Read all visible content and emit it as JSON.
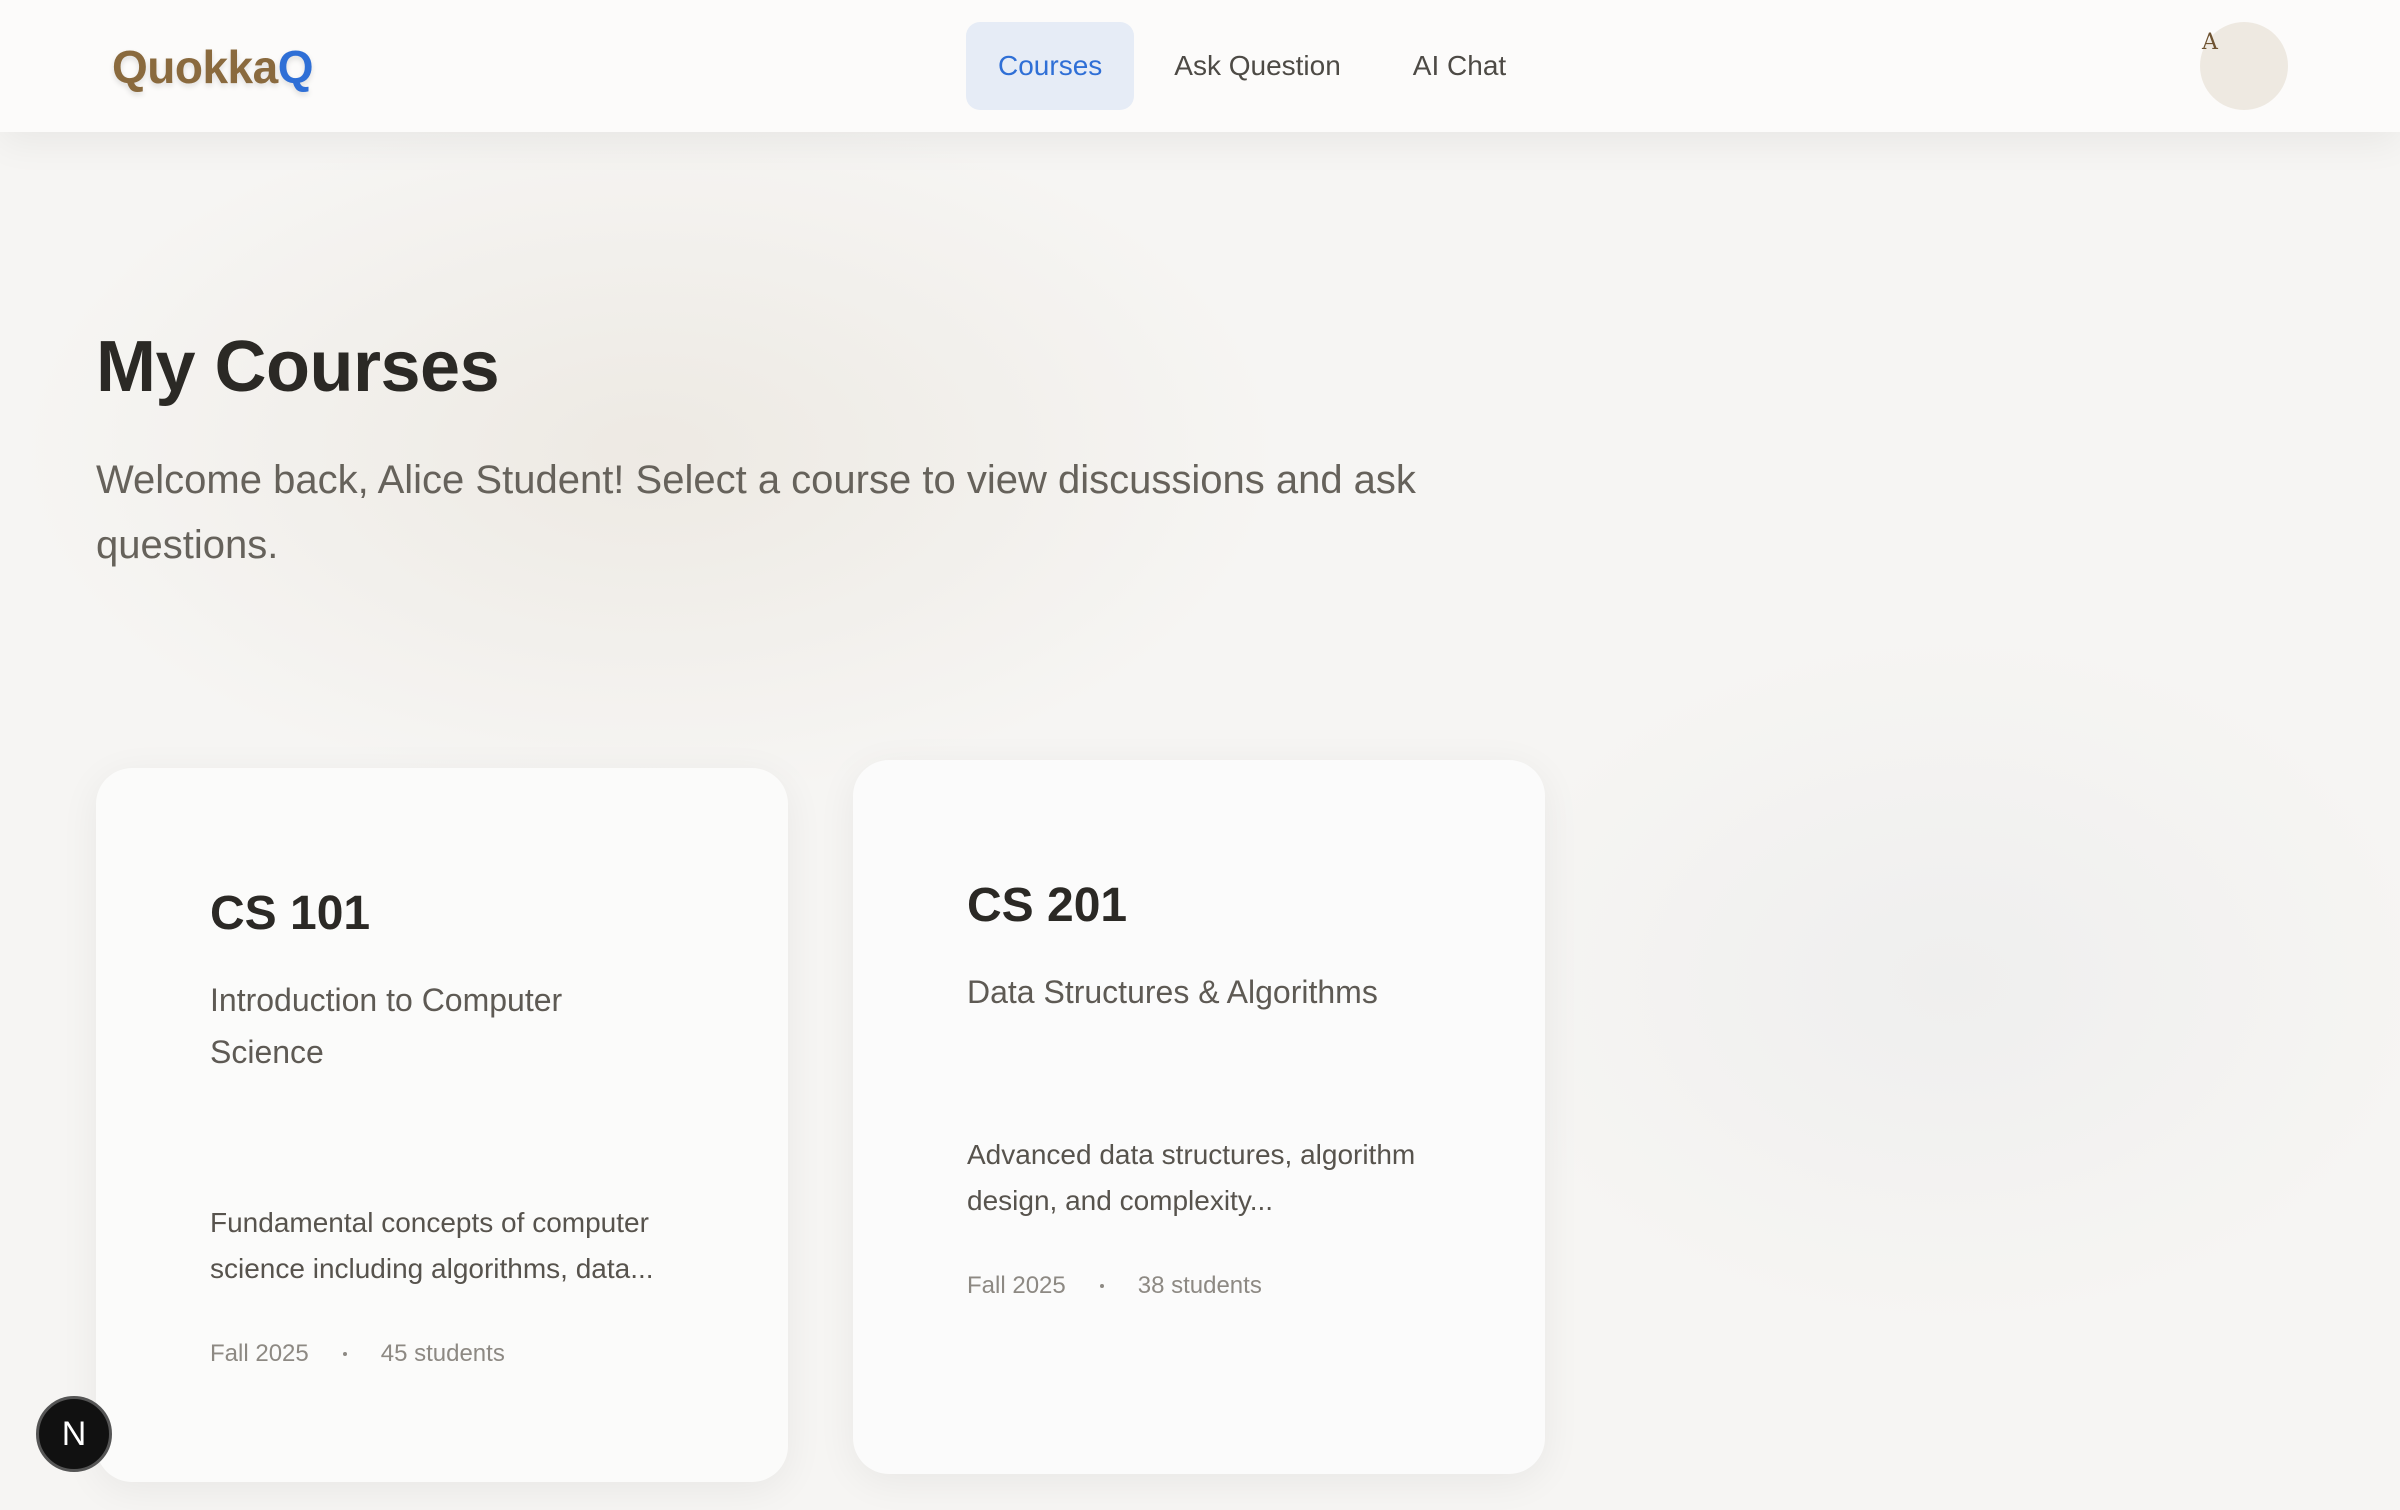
{
  "brand": {
    "name_main": "Quokka",
    "name_accent": "Q",
    "color_main": "#8a6a3e",
    "color_accent": "#2f6fd6"
  },
  "nav": {
    "items": [
      {
        "label": "Courses",
        "active": true
      },
      {
        "label": "Ask Question",
        "active": false
      },
      {
        "label": "AI Chat",
        "active": false
      }
    ],
    "active_color": "#2f6fd6",
    "active_bg": "#e6ecf6"
  },
  "user": {
    "avatar_initial": "A"
  },
  "main": {
    "title": "My Courses",
    "subtitle": "Welcome back, Alice Student! Select a course to view discussions and ask questions."
  },
  "courses": [
    {
      "code": "CS 101",
      "name": "Introduction to Computer Science",
      "description": "Fundamental concepts of computer science including algorithms, data...",
      "term": "Fall 2025",
      "students": "45 students"
    },
    {
      "code": "CS 201",
      "name": "Data Structures & Algorithms",
      "description": "Advanced data structures, algorithm design, and complexity...",
      "term": "Fall 2025",
      "students": "38 students"
    }
  ],
  "dev_badge": {
    "label": "N",
    "icon": "nextjs-dev-indicator-icon"
  }
}
